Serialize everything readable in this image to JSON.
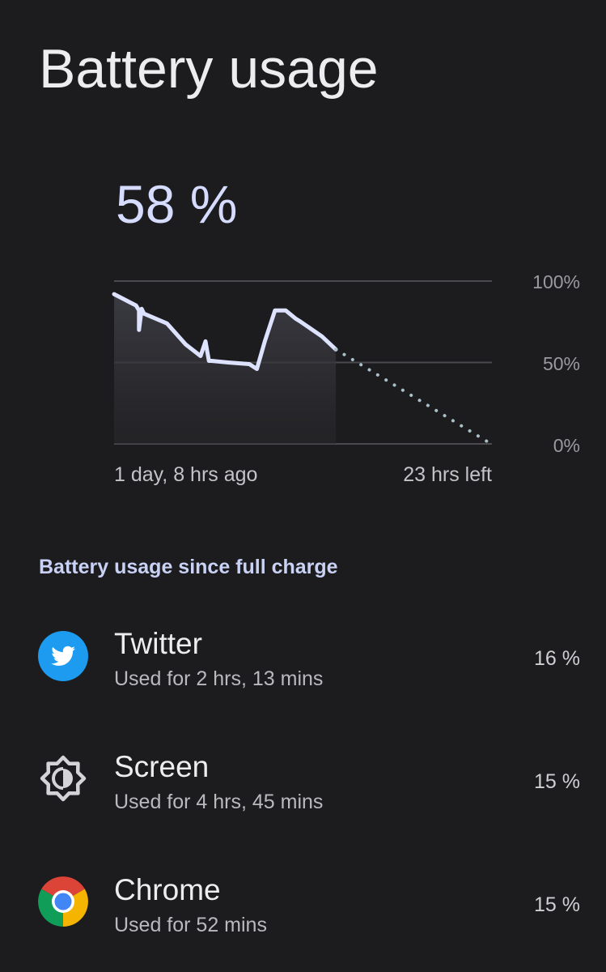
{
  "title": "Battery usage",
  "battery_percent": "58 %",
  "chart_data": {
    "type": "line",
    "y_tick_labels": [
      "100%",
      "50%",
      "0%"
    ],
    "x_labels": [
      "1 day, 8 hrs ago",
      "23 hrs left"
    ],
    "ylim": [
      0,
      100
    ],
    "x": [
      0,
      0.058,
      0.066,
      0.066,
      0.073,
      0.079,
      0.14,
      0.19,
      0.229,
      0.242,
      0.251,
      0.258,
      0.302,
      0.358,
      0.378,
      0.399,
      0.426,
      0.454,
      0.48,
      0.494,
      0.55,
      0.587
    ],
    "series": [
      {
        "values": [
          92,
          85,
          82,
          70,
          83,
          80,
          74,
          61,
          54,
          63,
          51,
          51,
          50,
          49,
          46,
          63,
          82,
          82,
          77,
          75,
          66,
          58
        ],
        "style": "solid"
      },
      {
        "x": [
          0.587,
          1.0
        ],
        "values": [
          58,
          0
        ],
        "style": "dotted"
      }
    ],
    "grid": true,
    "line_color": "#dde2ff",
    "projection_color": "#a9c0c8"
  },
  "section_title": "Battery usage since full charge",
  "apps": [
    {
      "name": "Twitter",
      "usage": "Used for 2 hrs, 13 mins",
      "percent": "16 %",
      "icon": "twitter-icon"
    },
    {
      "name": "Screen",
      "usage": "Used for 4 hrs, 45 mins",
      "percent": "15 %",
      "icon": "screen-brightness-icon"
    },
    {
      "name": "Chrome",
      "usage": "Used for 52 mins",
      "percent": "15 %",
      "icon": "chrome-icon"
    }
  ],
  "colors": {
    "background": "#1c1c1e",
    "accent": "#d6dcff",
    "twitter_blue": "#1d9bf0"
  }
}
